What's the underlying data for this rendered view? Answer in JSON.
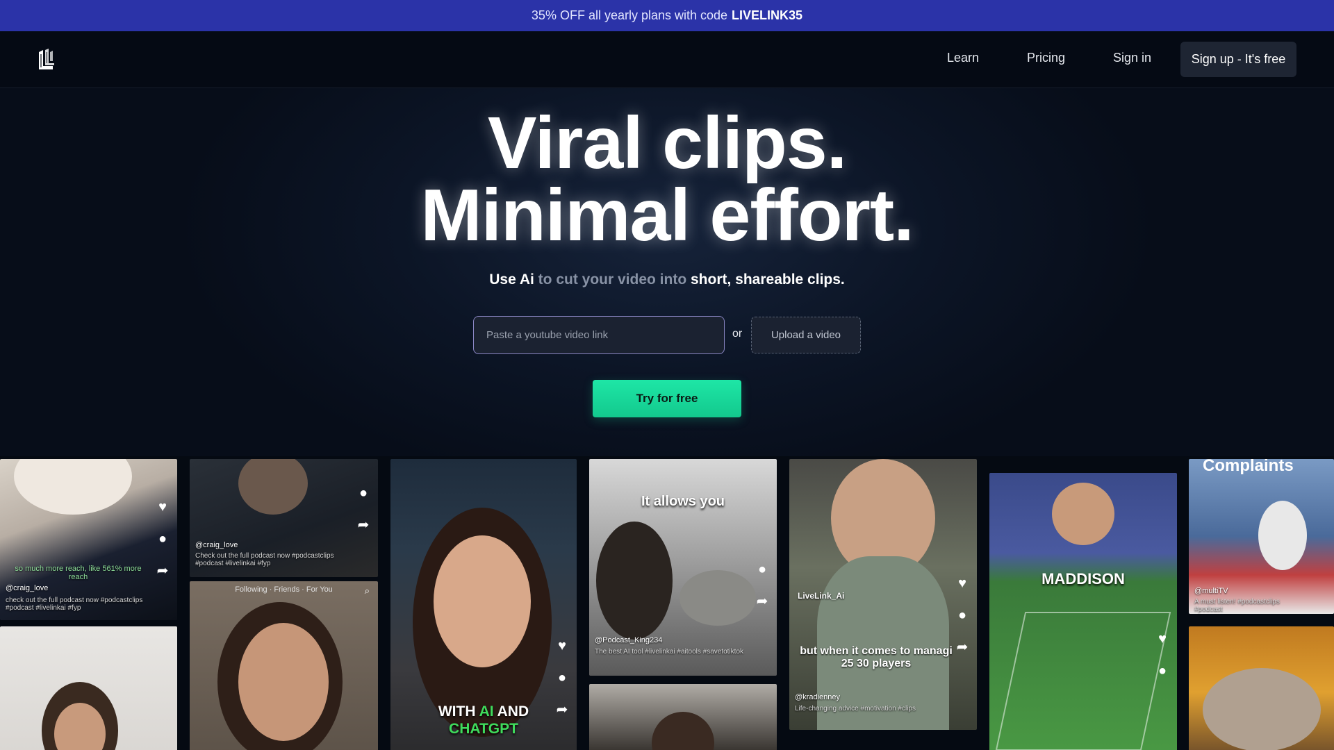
{
  "promo": {
    "text": "35% OFF all yearly plans with code",
    "code": "LIVELINK35"
  },
  "nav": {
    "logo_icon": "livelink-logo-icon",
    "links": [
      "Learn",
      "Pricing",
      "Sign in"
    ],
    "signup": "Sign up - It's free"
  },
  "hero": {
    "headline_1": "Viral clips.",
    "headline_2": "Minimal effort.",
    "sub_a": "Use Ai",
    "sub_b": " to cut your video into ",
    "sub_c": "short, shareable clips.",
    "input_placeholder": "Paste a youtube video link",
    "or": "or",
    "upload": "Upload a video",
    "cta": "Try for free"
  },
  "clips": {
    "c1_caption": "so much more reach, like 561% more reach",
    "c1_user": "@craig_love",
    "c1_desc": "check out the full podcast now #podcastclips #podcast #livelinkai #fyp",
    "c2_user": "@craig_love",
    "c2_desc": "Check out the full podcast now #podcastclips #podcast #livelinkai #fyp",
    "c3_tabs": "Following · Friends · For You",
    "c5_caption_1": "WITH",
    "c5_caption_ai": "AI",
    "c5_caption_2": "AND",
    "c5_caption_3": "CHATGPT",
    "c6_caption": "It allows you",
    "c6_user": "@Podcast_King234",
    "c6_desc": "The best AI tool #livelinkai #aitools #savetotiktok",
    "c8_brand": "LiveLink_Ai",
    "c8_caption": "but when it comes to managi 25 30 players",
    "c8_user": "@kradienney",
    "c8_desc": "Life-changing advice #motivation #clips",
    "c9_caption": "MADDISON",
    "c10_top": "Complaints",
    "c10_user": "@multiTV",
    "c10_desc": "A must listen! #podcastclips #podcast"
  },
  "colors": {
    "promo_bg": "#2b33a8",
    "cta": "#1ee6a6",
    "background": "#0a1220"
  }
}
